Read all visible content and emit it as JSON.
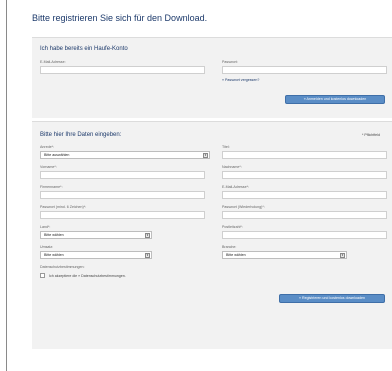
{
  "page_title": "Bitte registrieren Sie sich für den Download.",
  "login": {
    "heading": "Ich habe bereits ein Haufe-Konto",
    "email_label": "E-Mail-Adresse:",
    "password_label": "Passwort:",
    "forgot_link": "» Passwort vergessen?",
    "submit_label": "» Anmelden und kostenlos downloaden"
  },
  "register": {
    "heading": "Bitte hier Ihre Daten eingeben:",
    "required_note": "* Pflichtfeld",
    "anrede_label": "Anrede*:",
    "anrede_value": "Bitte auswählen",
    "titel_label": "Titel:",
    "vorname_label": "Vorname*:",
    "nachname_label": "Nachname*:",
    "firmenname_label": "Firmenname*:",
    "email_label": "E-Mail-Adresse*:",
    "passwort_label": "Passwort (mind. 6 Zeichen)*:",
    "passwort_repeat_label": "Passwort (Wiederholung)*:",
    "land_label": "Land*:",
    "land_value": "Bitte wählen",
    "postleitzahl_label": "Postleitzahl*:",
    "umsatz_label": "Umsatz:",
    "umsatz_value": "Bitte wählen",
    "branche_label": "Branche:",
    "branche_value": "Bitte wählen",
    "datenschutz_label": "Datenschutzbestimmungen:",
    "consent_text": "Ich akzeptiere die » Datenschutzbestimmungen.",
    "submit_label": "» Registrieren und kostenlos downloaden"
  }
}
